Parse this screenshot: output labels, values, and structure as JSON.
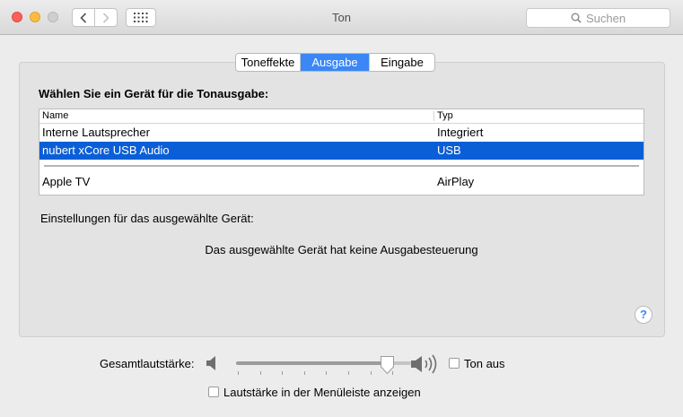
{
  "window": {
    "title": "Ton",
    "search_placeholder": "Suchen"
  },
  "tabs": [
    {
      "label": "Toneffekte",
      "active": false
    },
    {
      "label": "Ausgabe",
      "active": true
    },
    {
      "label": "Eingabe",
      "active": false
    }
  ],
  "output": {
    "heading": "Wählen Sie ein Gerät für die Tonausgabe:",
    "columns": {
      "name": "Name",
      "type": "Typ"
    },
    "devices": [
      {
        "name": "Interne Lautsprecher",
        "type": "Integriert",
        "selected": false
      },
      {
        "name": "nubert xCore USB Audio",
        "type": "USB",
        "selected": true
      },
      {
        "name": "Apple TV",
        "type": "AirPlay",
        "selected": false
      }
    ],
    "settings_label": "Einstellungen für das ausgewählte Gerät:",
    "no_control_text": "Das ausgewählte Gerät hat keine Ausgabesteuerung",
    "help_label": "?"
  },
  "volume": {
    "label": "Gesamtlautstärke:",
    "level": 0.9,
    "mute_label": "Ton aus",
    "mute_checked": false,
    "menubar_label": "Lautstärke in der Menüleiste anzeigen",
    "menubar_checked": false
  },
  "colors": {
    "accent": "#3a87f5",
    "selection": "#0b5fd6"
  },
  "icons": [
    "close-icon",
    "minimize-icon",
    "zoom-icon",
    "chevron-left-icon",
    "chevron-right-icon",
    "grid-icon",
    "search-icon",
    "speaker-low-icon",
    "speaker-high-icon",
    "help-icon"
  ]
}
